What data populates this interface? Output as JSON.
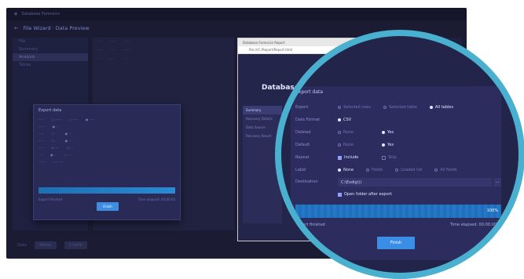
{
  "app": {
    "title": "Database Forensics",
    "nav_label": "File Wizard · Data Preview"
  },
  "browser": {
    "url": "file:///C:/Report/Report.html",
    "tab_label": "Database Forensics Report",
    "page_title": "Database Forensi",
    "sidebar": [
      {
        "label": "Summary",
        "active": true
      },
      {
        "label": "Recovery Details",
        "active": false
      },
      {
        "label": "Data Source",
        "active": false
      },
      {
        "label": "Recovery Result",
        "active": false
      }
    ]
  },
  "small_dialog": {
    "title": "Export data",
    "status": "Export finished",
    "time": "Time elapsed: 00:00:00",
    "button": "Finish",
    "progress_percent": 100
  },
  "export_dialog": {
    "title": "Export data",
    "rows": [
      {
        "label": "Export",
        "options": [
          {
            "text": "Selected rows",
            "type": "radio",
            "on": false
          },
          {
            "text": "Selected table",
            "type": "radio",
            "on": false
          },
          {
            "text": "All tables",
            "type": "radio",
            "on": true
          }
        ]
      },
      {
        "label": "Data Format",
        "options": [
          {
            "text": "CSV",
            "type": "radio",
            "on": true
          }
        ]
      },
      {
        "label": "Deleted",
        "options": [
          {
            "text": "None",
            "type": "radio",
            "on": false
          },
          {
            "text": "Yes",
            "type": "radio",
            "on": true
          }
        ]
      },
      {
        "label": "Default",
        "options": [
          {
            "text": "None",
            "type": "radio",
            "on": false
          },
          {
            "text": "Yes",
            "type": "radio",
            "on": true
          }
        ]
      },
      {
        "label": "Repeat",
        "options": [
          {
            "text": "Include",
            "type": "check",
            "on": true
          },
          {
            "text": "Skip",
            "type": "check",
            "on": false
          }
        ]
      },
      {
        "label": "Label",
        "options": [
          {
            "text": "None",
            "type": "radio",
            "on": true
          },
          {
            "text": "Fields",
            "type": "radio",
            "on": false
          },
          {
            "text": "Loaded list",
            "type": "radio",
            "on": false
          },
          {
            "text": "All fields",
            "type": "radio",
            "on": false
          }
        ]
      }
    ],
    "destination_label": "Destination",
    "destination_value": "C:\\Exdig\\()",
    "open_after_export": "Open folder after export",
    "progress_percent": 100,
    "progress_label": "100%",
    "status": "Export finished",
    "time": "Time elapsed: 00:00:00",
    "button": "Finish"
  },
  "left_tree": [
    "File",
    "Summary",
    "Analysis",
    "Tables"
  ],
  "bottom": {
    "left_label": "Data",
    "chip": "Tables",
    "right_chip": "1 table"
  },
  "colors": {
    "accent": "#3b8ee6",
    "lens_ring": "#4ab0cf",
    "dialog": "#2c2d5e",
    "background": "#1b1c33"
  }
}
